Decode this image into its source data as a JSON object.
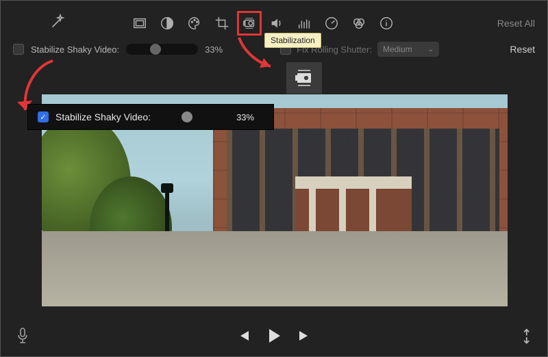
{
  "toolbar": {
    "reset_all_label": "Reset All"
  },
  "adjust": {
    "stabilize_label": "Stabilize Shaky Video:",
    "stabilize_checked": false,
    "stabilize_percent": "33%",
    "rolling_label": "Fix Rolling Shutter:",
    "rolling_value": "Medium",
    "reset_label": "Reset"
  },
  "tooltip": {
    "stabilization": "Stabilization"
  },
  "popover": {
    "stabilize_label": "Stabilize Shaky Video:",
    "stabilize_percent": "33%"
  },
  "icons": {
    "magic": "magic-wand-icon",
    "tools": [
      "frame-icon",
      "contrast-icon",
      "palette-icon",
      "crop-icon",
      "stabilization-icon",
      "volume-icon",
      "equalizer-icon",
      "speed-icon",
      "color-filter-icon",
      "info-icon"
    ]
  }
}
